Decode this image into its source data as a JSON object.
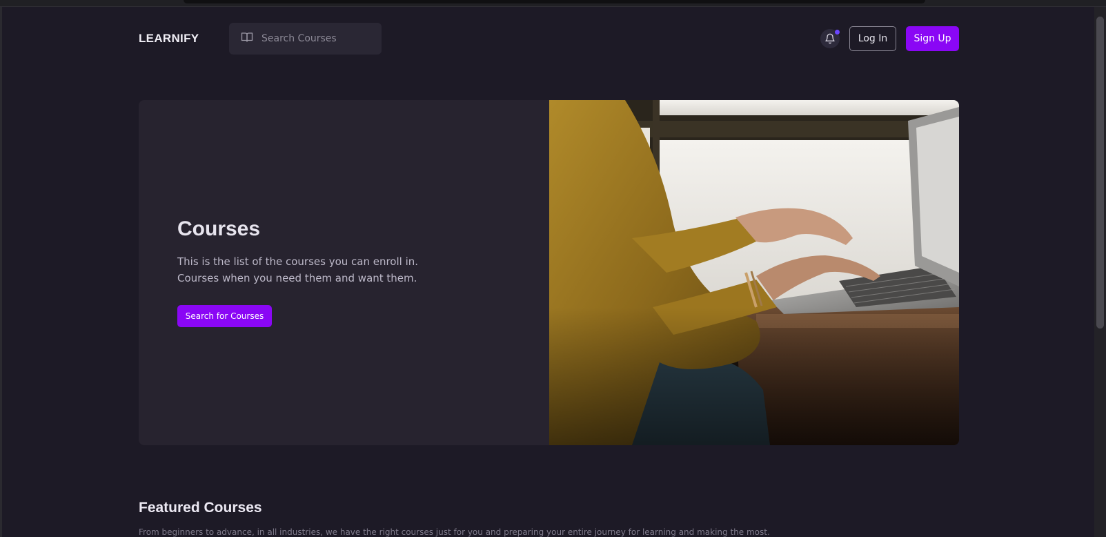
{
  "header": {
    "logo": "LEARNIFY",
    "search_placeholder": "Search Courses",
    "login_label": "Log In",
    "signup_label": "Sign Up"
  },
  "hero": {
    "title": "Courses",
    "description_line1": "This is the list of the courses you can enroll in.",
    "description_line2": "Courses when you need them and want them.",
    "cta_label": "Search for Courses"
  },
  "featured": {
    "title": "Featured Courses",
    "subtitle": "From beginners to advance, in all industries, we have the right courses just for you and preparing your entire journey for learning and making the most."
  },
  "icons": {
    "search": "book-open-icon",
    "notifications": "bell-icon"
  },
  "colors": {
    "background": "#1d1a26",
    "card": "#27232f",
    "accent": "#8a07f5",
    "notification_dot": "#6b46ff"
  }
}
